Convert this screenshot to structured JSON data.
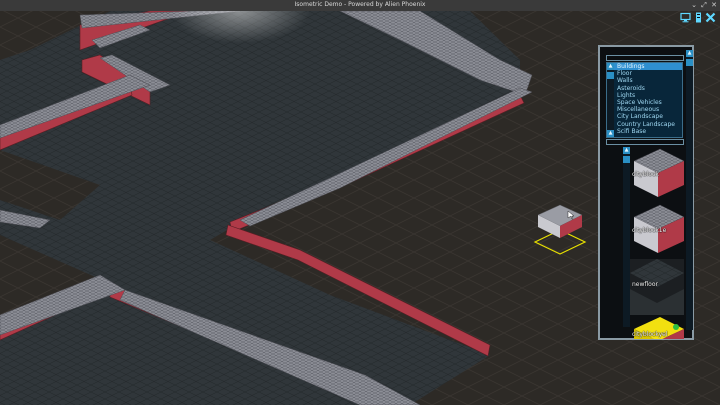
{
  "window": {
    "title": "Isometric Demo - Powered by Alien Phoenix",
    "controls": [
      "⌄",
      "⤢",
      "✕"
    ]
  },
  "system_icons": {
    "monitor": "monitor-icon",
    "pages": "pages-icon",
    "close": "close-x-icon",
    "accent": "#5fd8ff"
  },
  "panel": {
    "categories": [
      {
        "label": "Buildings",
        "selected": true
      },
      {
        "label": "Floor",
        "selected": false
      },
      {
        "label": "Walls",
        "selected": false
      },
      {
        "label": "Asteroids",
        "selected": false
      },
      {
        "label": "Lights",
        "selected": false
      },
      {
        "label": "Space Vehicles",
        "selected": false
      },
      {
        "label": "Miscellaneous",
        "selected": false
      },
      {
        "label": "City Landscape",
        "selected": false
      },
      {
        "label": "Country Landscape",
        "selected": false
      },
      {
        "label": "Scifi Base",
        "selected": false
      }
    ],
    "tiles": [
      {
        "label": "cityblock",
        "style": "grate-block"
      },
      {
        "label": "cityblock1e",
        "style": "grate-block"
      },
      {
        "label": "newfloor",
        "style": "dark-floor"
      },
      {
        "label": "cityblockyel",
        "style": "yellow-block"
      }
    ],
    "accent": "#2a8fc4"
  },
  "scene": {
    "floor_color": "#2f3438",
    "wall_color": "#b03a48",
    "cursor_color": "#e8e000"
  }
}
